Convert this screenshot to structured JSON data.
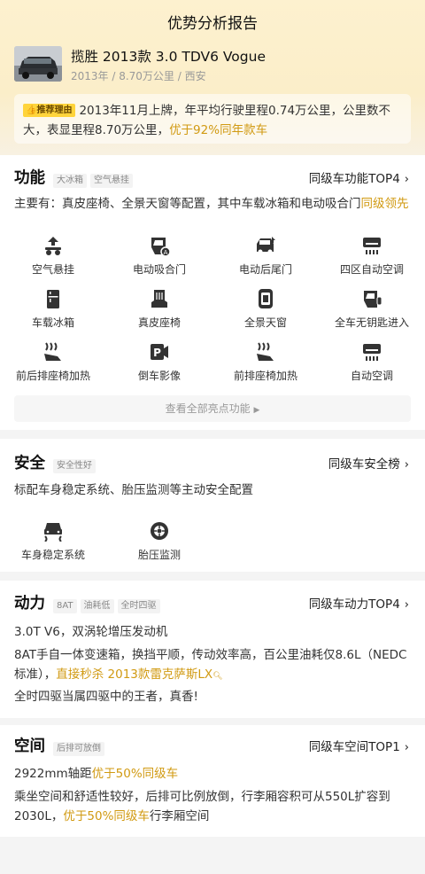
{
  "header": {
    "title": "优势分析报告"
  },
  "car": {
    "name": "揽胜 2013款 3.0 TDV6 Vogue",
    "meta": "2013年 / 8.70万公里 / 西安"
  },
  "recommend": {
    "tag": "推荐理由",
    "text": "2013年11月上牌，年平均行驶里程0.74万公里，公里数不大，表显里程8.70万公里，",
    "highlight": "优于92%同年款车"
  },
  "features": {
    "title": "功能",
    "tags": [
      "大冰箱",
      "空气悬挂"
    ],
    "link": "同级车功能TOP4",
    "desc_prefix": "主要有：真皮座椅、全景天窗等配置，其中车载冰箱和电动吸合门",
    "desc_highlight": "同级领先",
    "items": [
      {
        "label": "空气悬挂",
        "icon": "air-suspension-icon"
      },
      {
        "label": "电动吸合门",
        "icon": "soft-close-door-icon"
      },
      {
        "label": "电动后尾门",
        "icon": "power-tailgate-icon"
      },
      {
        "label": "四区自动空调",
        "icon": "four-zone-ac-icon"
      },
      {
        "label": "车载冰箱",
        "icon": "fridge-icon"
      },
      {
        "label": "真皮座椅",
        "icon": "leather-seat-icon"
      },
      {
        "label": "全景天窗",
        "icon": "panoramic-sunroof-icon"
      },
      {
        "label": "全车无钥匙进入",
        "icon": "keyless-entry-icon"
      },
      {
        "label": "前后排座椅加热",
        "icon": "seat-heating-icon"
      },
      {
        "label": "倒车影像",
        "icon": "parking-camera-icon"
      },
      {
        "label": "前排座椅加热",
        "icon": "front-seat-heating-icon"
      },
      {
        "label": "自动空调",
        "icon": "auto-ac-icon"
      }
    ],
    "view_all": "查看全部亮点功能"
  },
  "safety": {
    "title": "安全",
    "tags": [
      "安全性好"
    ],
    "link": "同级车安全榜",
    "desc": "标配车身稳定系统、胎压监测等主动安全配置",
    "items": [
      {
        "label": "车身稳定系统",
        "icon": "stability-control-icon"
      },
      {
        "label": "胎压监测",
        "icon": "tire-pressure-icon"
      }
    ]
  },
  "power": {
    "title": "动力",
    "tags": [
      "8AT",
      "油耗低",
      "全时四驱"
    ],
    "link": "同级车动力TOP4",
    "line1": "3.0T V6，双涡轮增压发动机",
    "line2": "8AT手自一体变速箱，换挡平顺，传动效率高，百公里油耗仅8.6L（NEDC标准），",
    "line2_highlight": "直接秒杀 2013款雷克萨斯LX",
    "line3": "全时四驱当属四驱中的王者，真香!"
  },
  "space": {
    "title": "空间",
    "tags": [
      "后排可放倒"
    ],
    "link": "同级车空间TOP1",
    "line1_prefix": "2922mm轴距",
    "line1_highlight": "优于50%同级车",
    "line2_prefix": "乘坐空间和舒适性较好，后排可比例放倒，行李厢容积可从550L扩容到2030L，",
    "line2_highlight": "优于50%同级车",
    "line2_suffix": "行李厢空间"
  },
  "colors": {
    "highlight": "#d19a12",
    "tag_yellow": "#ffd43b"
  }
}
